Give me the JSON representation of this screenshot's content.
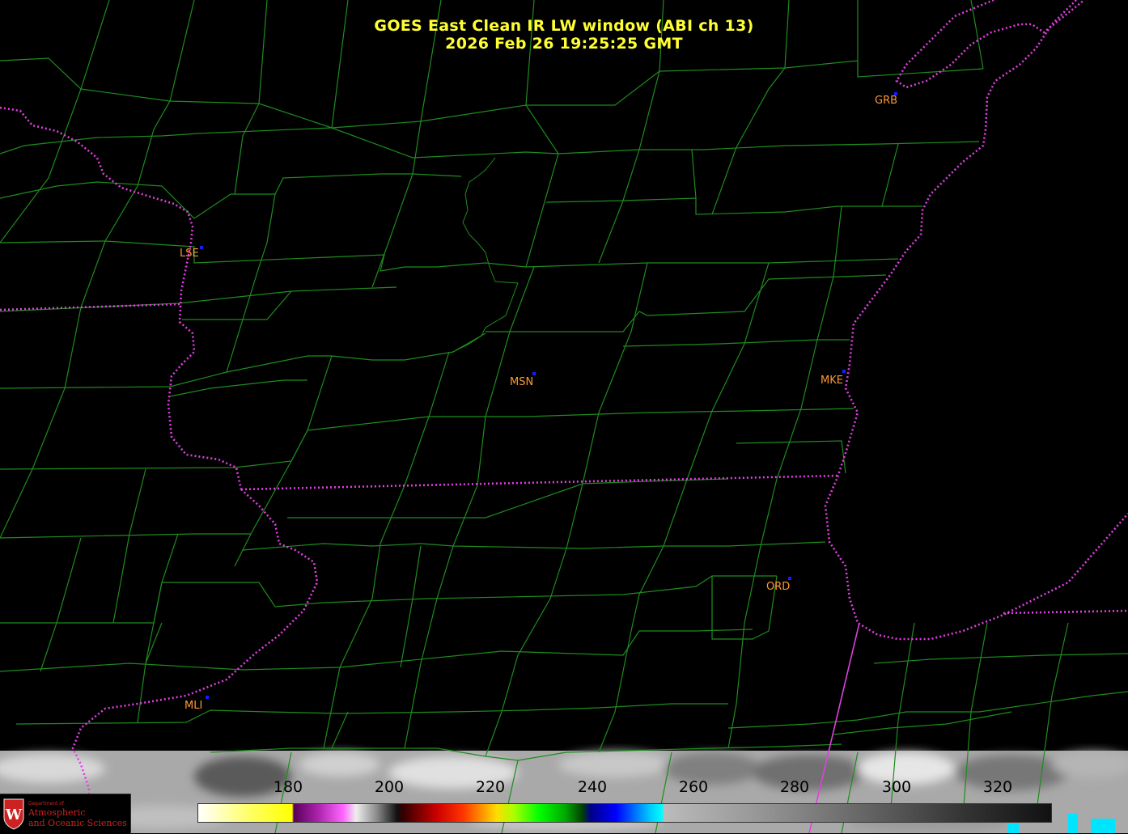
{
  "title": {
    "line1": "GOES East Clean IR LW window (ABI ch 13)",
    "line2": "2026 Feb 26  19:25:25 GMT"
  },
  "cities": [
    {
      "code": "GRB"
    },
    {
      "code": "LSE"
    },
    {
      "code": "MSN"
    },
    {
      "code": "MKE"
    },
    {
      "code": "ORD"
    },
    {
      "code": "MLI"
    }
  ],
  "colorbar": {
    "ticks": [
      "180",
      "200",
      "220",
      "240",
      "260",
      "280",
      "300",
      "320"
    ]
  },
  "logo": {
    "small": "Department of",
    "line1": "Atmospheric",
    "line2": "and Oceanic Sciences"
  },
  "colors": {
    "county_lines": "#1e8c1e",
    "state_borders": "#e040e0",
    "title_text": "#ffff33",
    "city_labels": "#ff9933",
    "city_markers": "#1a1aff",
    "logo_red": "#cc2222"
  }
}
